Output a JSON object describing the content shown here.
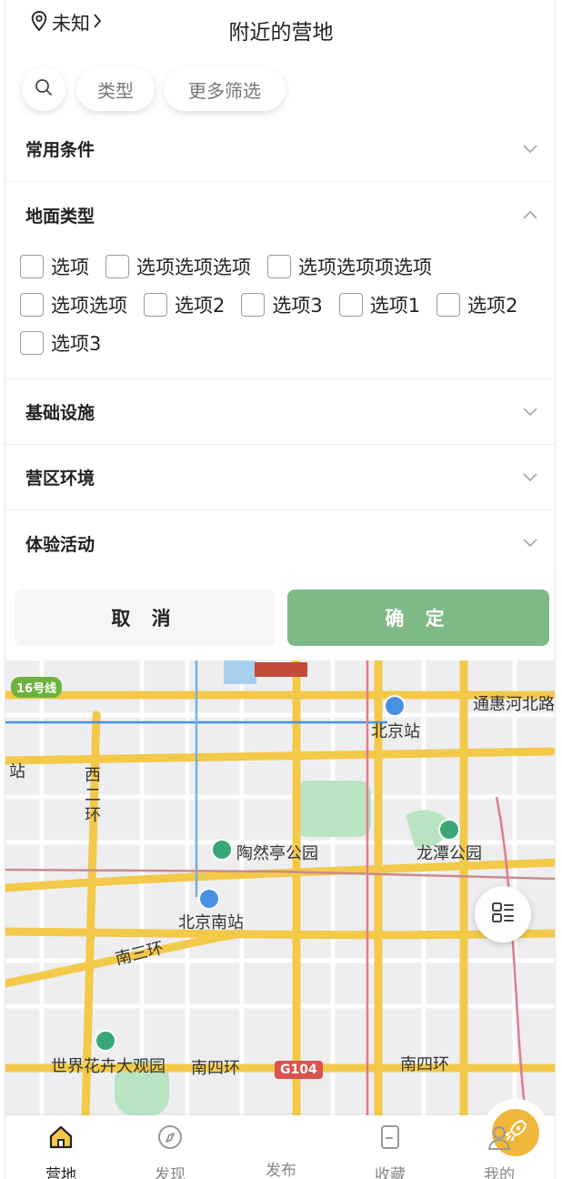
{
  "header": {
    "location": "未知",
    "title": "附近的营地"
  },
  "filters": {
    "type_label": "类型",
    "more_label": "更多筛选"
  },
  "panel": {
    "common": "常用条件",
    "ground": "地面类型",
    "ground_options": [
      "选项",
      "选项选项选项",
      "选项选项项选项",
      "选项选项",
      "选项2",
      "选项3",
      "选项1",
      "选项2",
      "选项3"
    ],
    "facilities": "基础设施",
    "environment": "营区环境",
    "activities": "体验活动"
  },
  "buttons": {
    "cancel": "取 消",
    "confirm": "确 定"
  },
  "map": {
    "labels": {
      "beijing_station": "北京站",
      "tonghui": "通惠河北路",
      "west2": "西二环",
      "taoranting": "陶然亭公园",
      "longtan": "龙潭公园",
      "beijing_south": "北京南站",
      "south3": "南三环",
      "world_flower": "世界花卉大观园",
      "south4_a": "南四环",
      "south4_b": "南四环",
      "g104": "G104",
      "line16": "16号线",
      "station_left": "站"
    }
  },
  "tabbar": {
    "items": [
      {
        "label": "营地",
        "icon": "home-icon"
      },
      {
        "label": "发现",
        "icon": "compass-icon"
      },
      {
        "label": "发布",
        "icon": "rocket-icon"
      },
      {
        "label": "收藏",
        "icon": "bookmark-icon"
      },
      {
        "label": "我的",
        "icon": "user-icon"
      }
    ]
  },
  "colors": {
    "accent": "#7dba86",
    "publish": "#f0b73a"
  }
}
